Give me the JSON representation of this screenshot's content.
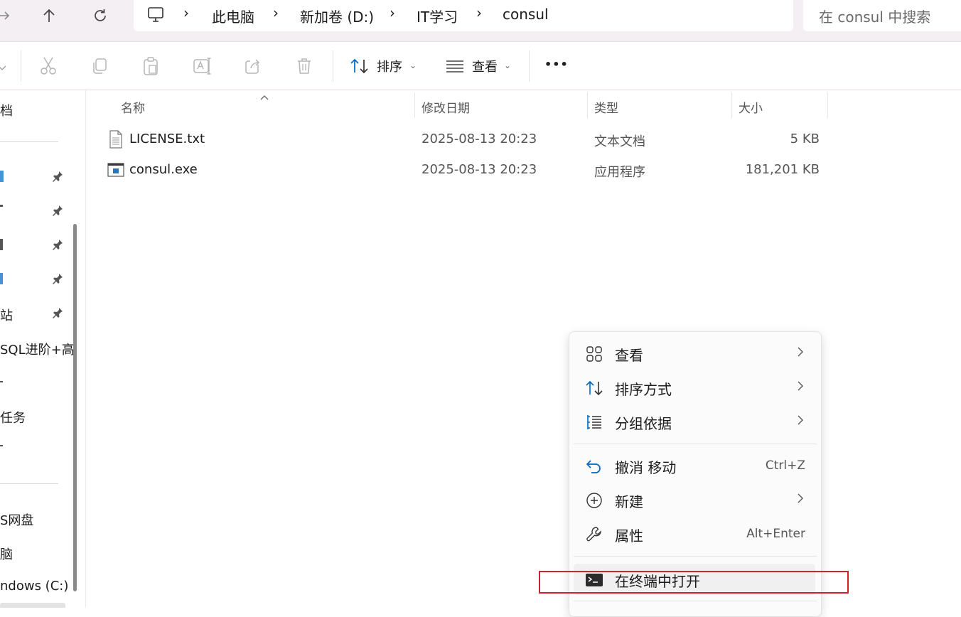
{
  "breadcrumb": [
    "此电脑",
    "新加卷 (D:)",
    "IT学习",
    "consul"
  ],
  "search": {
    "placeholder": "在 consul 中搜索"
  },
  "toolbar": {
    "sort_label": "排序",
    "view_label": "查看",
    "more_label": "•••"
  },
  "sidebar": {
    "items": [
      {
        "label": "档",
        "pinned": false
      },
      {
        "label": "",
        "pinned": true
      },
      {
        "label": "",
        "pinned": true
      },
      {
        "label": "",
        "pinned": true
      },
      {
        "label": "",
        "pinned": true
      },
      {
        "label": "站",
        "pinned": true
      },
      {
        "label": "SQL进阶+高",
        "pinned": false
      },
      {
        "label": "任务",
        "pinned": false
      },
      {
        "label": "S网盘",
        "pinned": false
      },
      {
        "label": "脑",
        "pinned": false
      },
      {
        "label": "ndows (C:)",
        "pinned": false
      }
    ]
  },
  "columns": {
    "name": "名称",
    "modified": "修改日期",
    "type": "类型",
    "size": "大小"
  },
  "files": [
    {
      "name": "LICENSE.txt",
      "modified": "2025-08-13 20:23",
      "type": "文本文档",
      "size": "5 KB",
      "icon": "text-file-icon"
    },
    {
      "name": "consul.exe",
      "modified": "2025-08-13 20:23",
      "type": "应用程序",
      "size": "181,201 KB",
      "icon": "exe-file-icon"
    }
  ],
  "context_menu": {
    "view": "查看",
    "sort": "排序方式",
    "group": "分组依据",
    "undo": "撤消 移动",
    "undo_shortcut": "Ctrl+Z",
    "new": "新建",
    "properties": "属性",
    "properties_shortcut": "Alt+Enter",
    "terminal": "在终端中打开"
  },
  "colors": {
    "accent": "#0067c0",
    "highlight_box": "#d3232a"
  }
}
